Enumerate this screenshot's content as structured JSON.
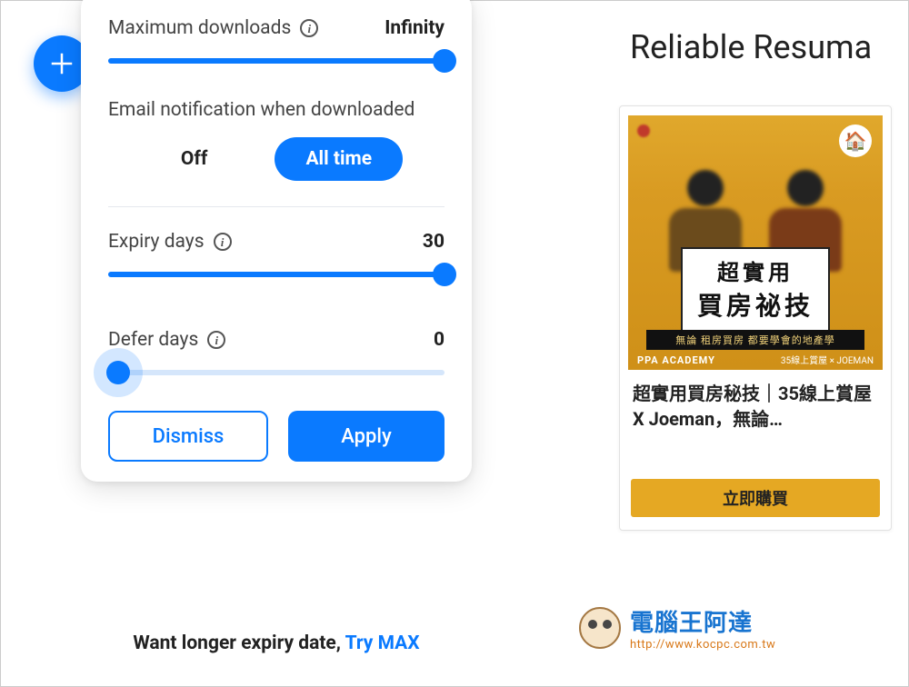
{
  "header": {
    "subtitle": "Reliable Resuma"
  },
  "panel": {
    "max_downloads": {
      "label": "Maximum downloads",
      "value": "Infinity",
      "percent": 100
    },
    "email_notification": {
      "title": "Email notification when downloaded",
      "off_label": "Off",
      "on_label": "All time",
      "selected": "on"
    },
    "expiry_days": {
      "label": "Expiry days",
      "value": "30",
      "percent": 100
    },
    "defer_days": {
      "label": "Defer days",
      "value": "0",
      "percent": 0
    },
    "dismiss_label": "Dismiss",
    "apply_label": "Apply"
  },
  "footer": {
    "text": "Want longer expiry date, ",
    "link": "Try MAX"
  },
  "ad": {
    "image_line1": "超實用",
    "image_line2": "買房祕技",
    "image_strip": "無論 租房買房 都要學會的地產學",
    "ppa": "PPA ACADEMY",
    "joeman": "35線上賞屋 × JOEMAN",
    "title": "超實用買房秘技｜35線上賞屋 X Joeman，無論…",
    "cta": "立即購買"
  },
  "watermark": {
    "name": "電腦王阿達",
    "url": "http://www.kocpc.com.tw"
  }
}
